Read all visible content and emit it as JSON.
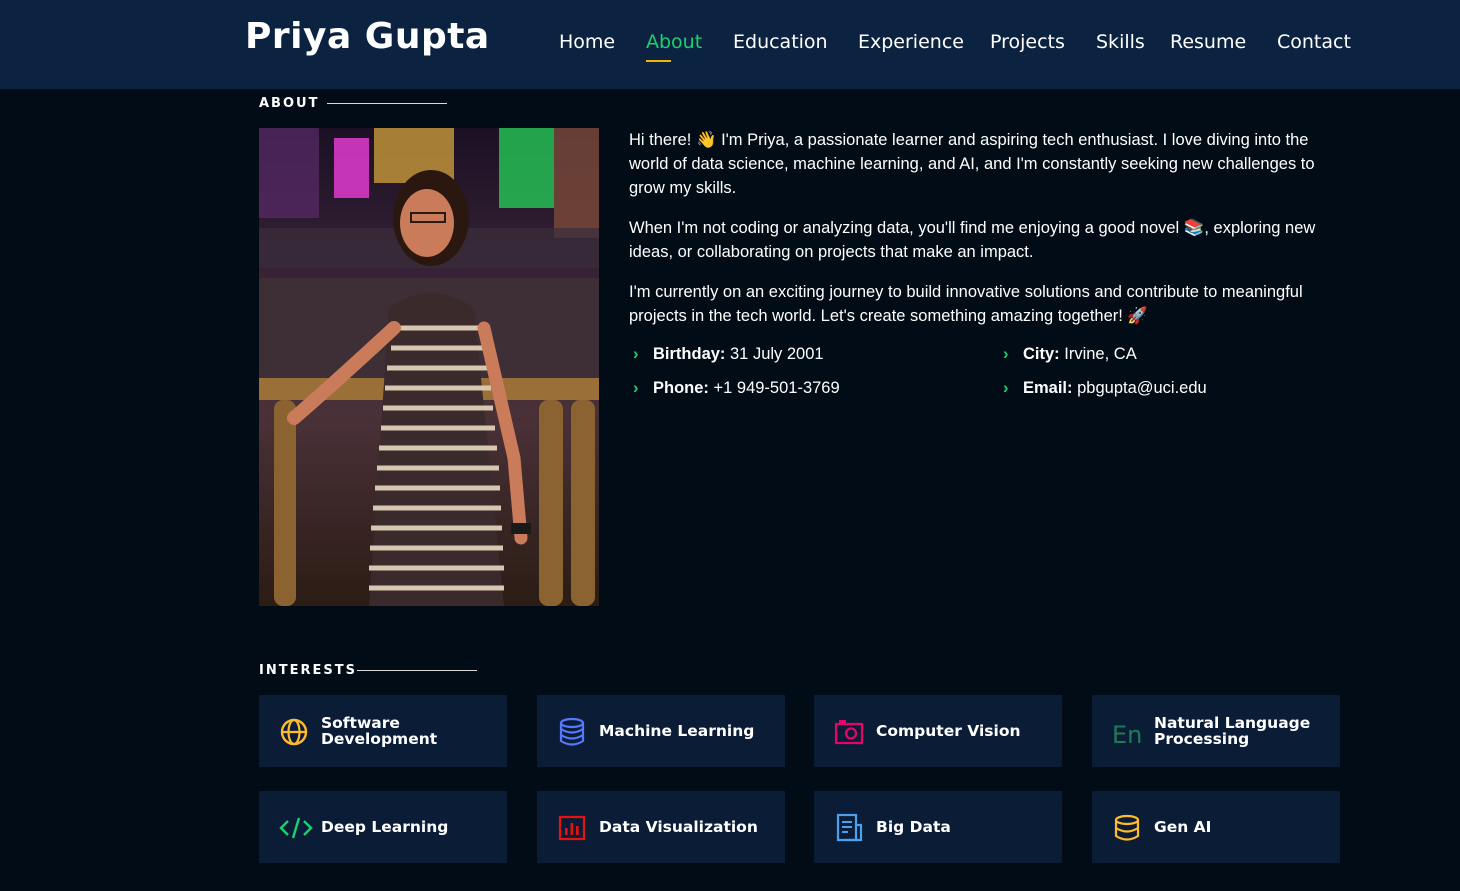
{
  "header": {
    "brand": "Priya Gupta",
    "nav": [
      {
        "label": "Home",
        "active": false
      },
      {
        "label": "About",
        "active": true
      },
      {
        "label": "Education",
        "active": false
      },
      {
        "label": "Experience",
        "active": false
      },
      {
        "label": "Projects",
        "active": false
      },
      {
        "label": "Skills",
        "active": false
      },
      {
        "label": "Resume",
        "active": false
      },
      {
        "label": "Contact",
        "active": false
      }
    ]
  },
  "about": {
    "section_title": "ABOUT",
    "paragraphs": [
      "Hi there! 👋 I'm Priya, a passionate learner and aspiring tech enthusiast. I love diving into the world of data science, machine learning, and AI, and I'm constantly seeking new challenges to grow my skills.",
      "When I'm not coding or analyzing data, you'll find me enjoying a good novel 📚, exploring new ideas, or collaborating on projects that make an impact.",
      "I'm currently on an exciting journey to build innovative solutions and contribute to meaningful projects in the tech world. Let's create something amazing together! 🚀"
    ],
    "info": [
      {
        "label": "Birthday:",
        "value": " 31 July 2001"
      },
      {
        "label": "City:",
        "value": " Irvine, CA"
      },
      {
        "label": "Phone:",
        "value": " +1 949-501-3769"
      },
      {
        "label": "Email:",
        "value": " pbgupta@uci.edu"
      }
    ]
  },
  "interests": {
    "section_title": "INTERESTS",
    "items": [
      {
        "label": "Software Development",
        "icon": "globe-icon",
        "color": "#ffbb2c"
      },
      {
        "label": "Machine Learning",
        "icon": "database-icon",
        "color": "#5578ff"
      },
      {
        "label": "Computer Vision",
        "icon": "camera-icon",
        "color": "#e80368"
      },
      {
        "label": "Natural Language Processing",
        "icon": "language-icon",
        "color": "#1c7c54"
      },
      {
        "label": "Deep Learning",
        "icon": "code-icon",
        "color": "#18d26e"
      },
      {
        "label": "Data Visualization",
        "icon": "bar-chart-icon",
        "color": "#e81111"
      },
      {
        "label": "Big Data",
        "icon": "document-icon",
        "color": "#4ba0f0"
      },
      {
        "label": "Gen AI",
        "icon": "coins-icon",
        "color": "#ffbb2c"
      }
    ]
  },
  "colors": {
    "accent": "#18d26e",
    "header_bg": "#0b2340",
    "page_bg": "#010c17",
    "card_bg": "#0b1d36"
  }
}
